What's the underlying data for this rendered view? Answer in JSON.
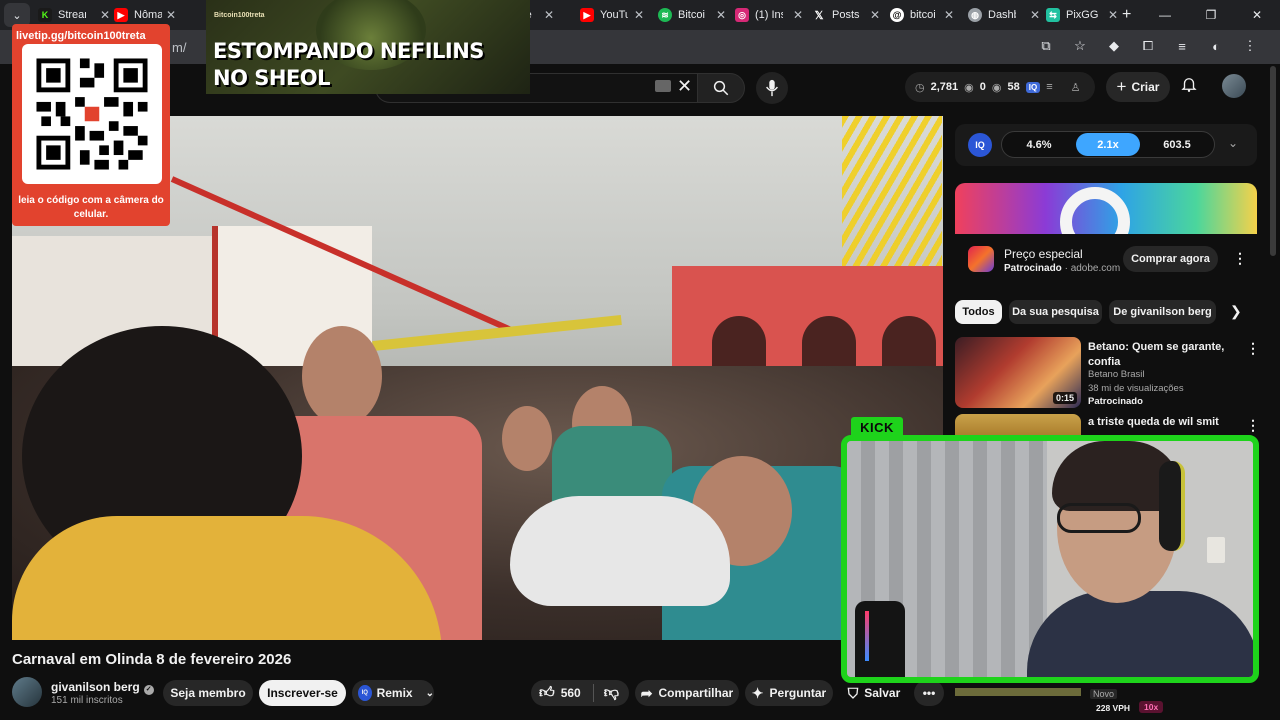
{
  "browser": {
    "tabs": [
      {
        "label": "Stream",
        "favicon": "kick-icon",
        "color": "#53fc18"
      },
      {
        "label": "Nôma",
        "favicon": "youtube-icon",
        "color": "#ff0000"
      },
      {
        "label": "",
        "favicon": "youtube-icon",
        "color": "#ff0000"
      },
      {
        "label": "io e",
        "favicon": "youtube-icon",
        "color": "#ff0000"
      },
      {
        "label": "YouTu",
        "favicon": "youtube-icon",
        "color": "#ff0000"
      },
      {
        "label": "Bitcoi",
        "favicon": "spotify-icon",
        "color": "#1db954"
      },
      {
        "label": "(1) Ins",
        "favicon": "instagram-icon",
        "color": "#d62976"
      },
      {
        "label": "Posts",
        "favicon": "x-icon",
        "color": "#000000"
      },
      {
        "label": "bitcoi",
        "favicon": "threads-icon",
        "color": "#000000"
      },
      {
        "label": "Dashb",
        "favicon": "dashboard-icon",
        "color": "#9aa0a6"
      },
      {
        "label": "PixGG",
        "favicon": "pixgg-icon",
        "color": "#22c1a0"
      }
    ],
    "url_fragment": "m/"
  },
  "overlay": {
    "qr_url": "livetip.gg/bitcoin100treta",
    "qr_caption": "leia o código com a câmera do celular.",
    "banner_small": "Bitcoin100treta",
    "banner_title": "ESTOMPANDO NEFILINS NO SHEOL",
    "kick_label": "KICK"
  },
  "header": {
    "stats": {
      "views": "2,781",
      "eye1": "0",
      "eye2": "58"
    },
    "create_label": "Criar"
  },
  "video": {
    "title": "Carnaval em Olinda 8 de fevereiro 2026",
    "channel": "givanilson berg",
    "subscribers": "151 mil inscritos",
    "member_label": "Seja membro",
    "subscribe_label": "Inscrever-se",
    "remix_label": "Remix",
    "likes": "560",
    "share_label": "Compartilhar",
    "ask_label": "Perguntar",
    "save_label": "Salvar"
  },
  "iq": {
    "left": "4.6%",
    "mid": "2.1x",
    "right": "603.5",
    "accent": "#1a73e8"
  },
  "ad": {
    "title": "Preço especial",
    "sponsored": "Patrocinado",
    "domain": "adobe.com",
    "cta": "Comprar agora"
  },
  "chips": [
    "Todos",
    "Da sua pesquisa",
    "De givanilson berg"
  ],
  "recs": [
    {
      "title": "Betano: Quem se garante, confia",
      "channel": "Betano Brasil",
      "views": "38 mi de visualizações",
      "badge": "Patrocinado",
      "duration": "0:15"
    },
    {
      "title": "a triste queda de wil smit"
    }
  ],
  "bottom": {
    "novo": "Novo",
    "vph": "228 VPH",
    "multiplier": "10x"
  }
}
